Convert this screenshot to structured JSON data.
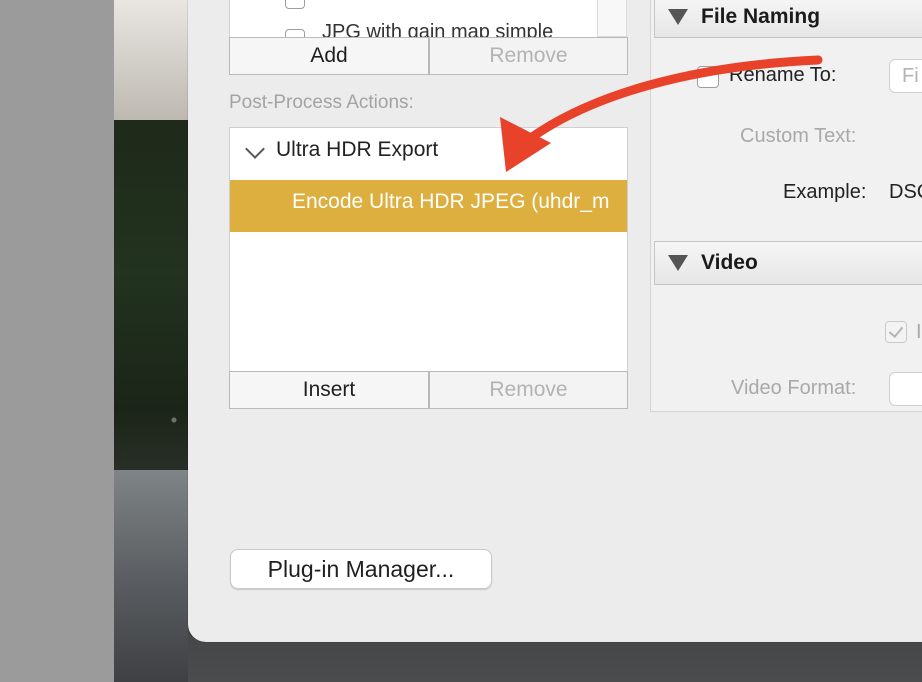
{
  "preset_list": {
    "partial_item": "JPG with gain map simple"
  },
  "preset_buttons": {
    "add": "Add",
    "remove": "Remove"
  },
  "post_process": {
    "label": "Post-Process Actions:",
    "group_name": "Ultra HDR Export",
    "selected_action": "Encode Ultra HDR JPEG (uhdr_m",
    "insert": "Insert",
    "remove": "Remove",
    "highlight_color": "#dcaf3f"
  },
  "file_naming": {
    "title": "File Naming",
    "rename_label": "Rename To:",
    "rename_value": "Fi",
    "custom_text_label": "Custom Text:",
    "example_label": "Example:",
    "example_value": "DSC"
  },
  "video": {
    "title": "Video",
    "include_checkbox_text": "I",
    "format_label": "Video Format:"
  },
  "plugin_manager": {
    "label": "Plug-in Manager..."
  },
  "annotation": {
    "arrow_color": "#e8432a"
  }
}
